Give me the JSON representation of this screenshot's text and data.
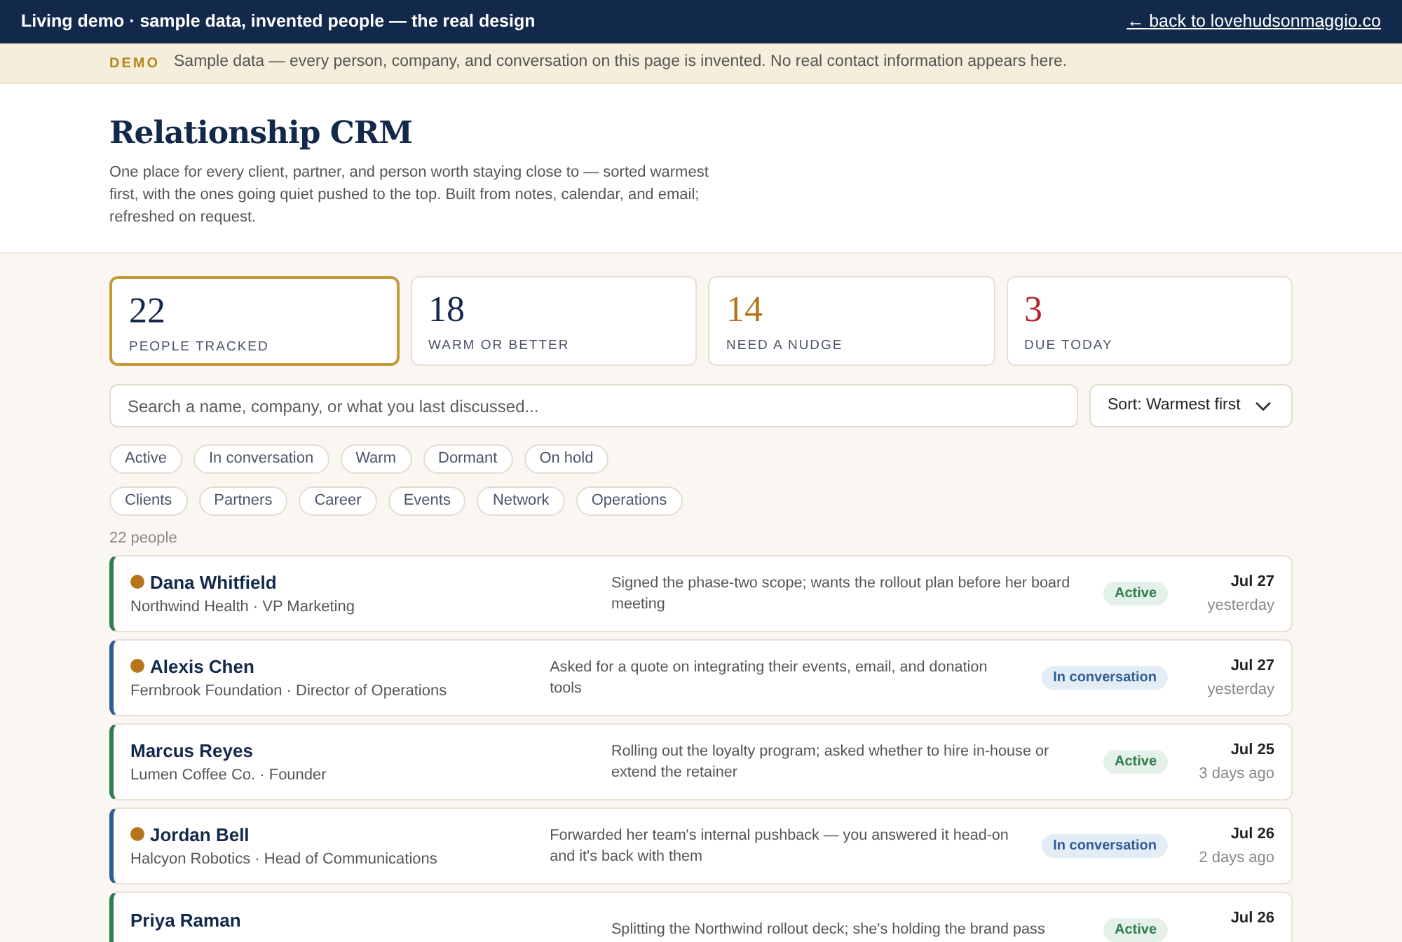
{
  "topbar": {
    "title": "Living demo · sample data, invented people — the real design",
    "link": "← back to lovehudsonmaggio.co"
  },
  "notice": {
    "tag": "DEMO",
    "text": "Sample data — every person, company, and conversation on this page is invented. No real contact information appears here."
  },
  "hero": {
    "title": "Relationship CRM",
    "description": "One place for every client, partner, and person worth staying close to — sorted warmest first, with the ones going quiet pushed to the top. Built from notes, calendar, and email; refreshed on request."
  },
  "stats": [
    {
      "value": "22",
      "label": "PEOPLE TRACKED",
      "selected": true,
      "color": "#13294b"
    },
    {
      "value": "18",
      "label": "WARM OR BETTER",
      "selected": false,
      "color": "#13294b"
    },
    {
      "value": "14",
      "label": "NEED A NUDGE",
      "selected": false,
      "color": "#b5761b"
    },
    {
      "value": "3",
      "label": "DUE TODAY",
      "selected": false,
      "color": "#b3262b"
    }
  ],
  "search": {
    "placeholder": "Search a name, company, or what you last discussed..."
  },
  "sort": {
    "value": "Sort: Warmest first"
  },
  "status_filters": [
    {
      "label": "Active",
      "selected": false
    },
    {
      "label": "In conversation",
      "selected": false
    },
    {
      "label": "Warm",
      "selected": false
    },
    {
      "label": "Dormant",
      "selected": false
    },
    {
      "label": "On hold",
      "selected": false
    }
  ],
  "category_filters": [
    {
      "label": "Clients",
      "selected": false
    },
    {
      "label": "Partners",
      "selected": false
    },
    {
      "label": "Career",
      "selected": false
    },
    {
      "label": "Events",
      "selected": false
    },
    {
      "label": "Network",
      "selected": false
    },
    {
      "label": "Operations",
      "selected": false
    }
  ],
  "count": "22 people",
  "people": [
    {
      "name": "Dana Whitfield",
      "subtitle": "Northwind Health · VP Marketing",
      "nudge": true,
      "note": "Signed the phase-two scope; wants the rollout plan before her board meeting",
      "status": {
        "kind": "active",
        "label": "Active"
      },
      "date": "Jul 27",
      "ago": "yesterday"
    },
    {
      "name": "Alexis Chen",
      "subtitle": "Fernbrook Foundation · Director of Operations",
      "nudge": true,
      "note": "Asked for a quote on integrating their events, email, and donation tools",
      "status": {
        "kind": "conversation",
        "label": "In conversation"
      },
      "date": "Jul 27",
      "ago": "yesterday"
    },
    {
      "name": "Marcus Reyes",
      "subtitle": "Lumen Coffee Co. · Founder",
      "nudge": false,
      "note": "Rolling out the loyalty program; asked whether to hire in-house or extend the retainer",
      "status": {
        "kind": "active",
        "label": "Active"
      },
      "date": "Jul 25",
      "ago": "3 days ago"
    },
    {
      "name": "Jordan Bell",
      "subtitle": "Halcyon Robotics · Head of Communications",
      "nudge": true,
      "note": "Forwarded her team's internal pushback — you answered it head-on and it's back with them",
      "status": {
        "kind": "conversation",
        "label": "In conversation"
      },
      "date": "Jul 26",
      "ago": "2 days ago"
    },
    {
      "name": "Priya Raman",
      "nudge": false,
      "note": "Splitting the Northwind rollout deck; she's holding the brand pass",
      "status": {
        "kind": "active",
        "label": "Active"
      },
      "date": "Jul 26"
    }
  ]
}
